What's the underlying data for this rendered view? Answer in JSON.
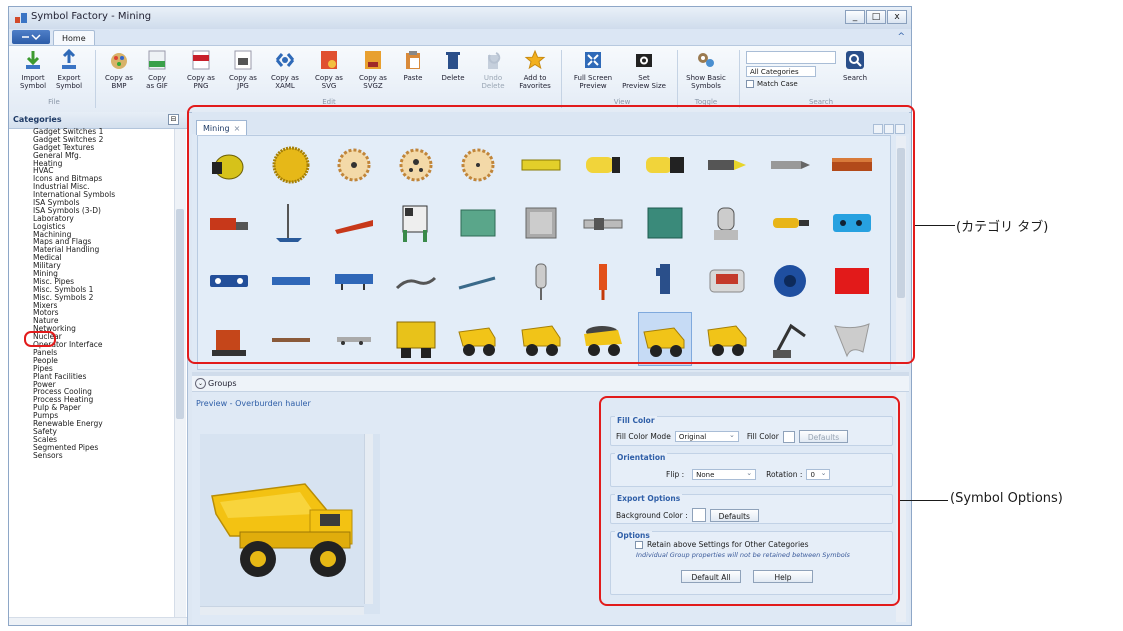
{
  "window": {
    "title": "Symbol Factory - Mining",
    "buttons": [
      "_",
      "□",
      "x"
    ]
  },
  "ribbon": {
    "tab": "Home",
    "collapse_glyph": "^",
    "buttons": [
      {
        "label": "Import\nSymbol",
        "icon": "import-icon"
      },
      {
        "label": "Export\nSymbol",
        "icon": "export-icon"
      },
      {
        "label": "Copy as\nBMP",
        "icon": "bmp-icon"
      },
      {
        "label": "Copy\nas GIF",
        "icon": "gif-icon"
      },
      {
        "label": "Copy as\nPNG",
        "icon": "png-icon"
      },
      {
        "label": "Copy as\nJPG",
        "icon": "jpg-icon"
      },
      {
        "label": "Copy as\nXAML",
        "icon": "xaml-icon"
      },
      {
        "label": "Copy as\nSVG",
        "icon": "svg-icon"
      },
      {
        "label": "Copy as\nSVGZ",
        "icon": "svgz-icon"
      },
      {
        "label": "Paste",
        "icon": "paste-icon"
      },
      {
        "label": "Delete",
        "icon": "delete-icon"
      },
      {
        "label": "Undo\nDelete",
        "icon": "undo-icon",
        "disabled": true
      },
      {
        "label": "Add to\nFavorites",
        "icon": "star-icon"
      },
      {
        "label": "Full Screen\nPreview",
        "icon": "fullscreen-icon"
      },
      {
        "label": "Set\nPreview Size",
        "icon": "camera-icon"
      },
      {
        "label": "Show Basic\nSymbols",
        "icon": "gears-icon"
      },
      {
        "label": "Search",
        "icon": "search-icon"
      }
    ],
    "groups": [
      "File",
      "Edit",
      "View",
      "Toggle",
      "Search"
    ],
    "search": {
      "category_value": "All Categories",
      "match_case_label": "Match Case"
    }
  },
  "categories": {
    "title": "Categories",
    "pin": "⊟",
    "items": [
      "Gadget Switches 1",
      "Gadget Switches 2",
      "Gadget Textures",
      "General Mfg.",
      "Heating",
      "HVAC",
      "Icons and Bitmaps",
      "Industrial Misc.",
      "International Symbols",
      "ISA Symbols",
      "ISA Symbols (3-D)",
      "Laboratory",
      "Logistics",
      "Machining",
      "Maps and Flags",
      "Material Handling",
      "Medical",
      "Military",
      "Mining",
      "Misc. Pipes",
      "Misc. Symbols 1",
      "Misc. Symbols 2",
      "Mixers",
      "Motors",
      "Nature",
      "Networking",
      "Nuclear",
      "Operator Interface",
      "Panels",
      "People",
      "Pipes",
      "Plant Facilities",
      "Power",
      "Process Cooling",
      "Process Heating",
      "Pulp & Paper",
      "Pumps",
      "Renewable Energy",
      "Safety",
      "Scales",
      "Segmented Pipes",
      "Sensors"
    ],
    "selected": "Mining"
  },
  "gallery": {
    "tab_label": "Mining",
    "tab_close": "×",
    "selected_index": 40
  },
  "groups_bar": {
    "label": "Groups",
    "toggle": "⌄"
  },
  "preview": {
    "label": "Preview - Overburden hauler"
  },
  "options": {
    "fill_color": {
      "legend": "Fill Color",
      "mode_label": "Fill Color Mode",
      "mode_value": "Original",
      "color_label": "Fill Color",
      "defaults": "Defaults"
    },
    "orientation": {
      "legend": "Orientation",
      "flip_label": "Flip :",
      "flip_value": "None",
      "rotation_label": "Rotation :",
      "rotation_value": "0"
    },
    "export": {
      "legend": "Export Options",
      "bg_label": "Background Color :",
      "defaults": "Defaults"
    },
    "options": {
      "legend": "Options",
      "retain_label": "Retain above Settings for Other Categories",
      "note": "Individual Group properties will not be retained between Symbols",
      "default_all": "Default All",
      "help": "Help"
    }
  },
  "annotations": {
    "category_tab": "(カテゴリ タブ)",
    "symbol_options": "(Symbol Options)"
  },
  "colors": {
    "annotation_red": "#e21b1b",
    "accent_blue": "#2f5fa8"
  }
}
